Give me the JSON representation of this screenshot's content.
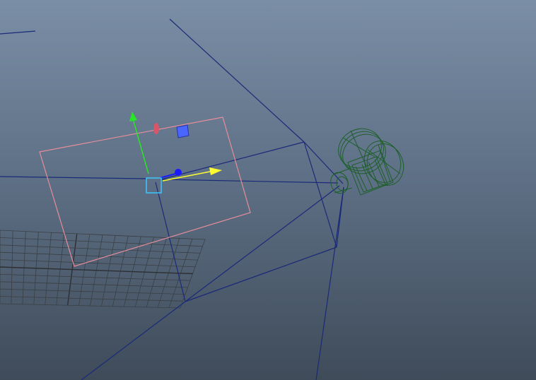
{
  "viewport": {
    "background_top": "#7a8ea5",
    "background_mid": "#5f7187",
    "background_bottom": "#3f4b59"
  },
  "colors": {
    "frustum": "#1a2a78",
    "grid": "#3a3f44",
    "grid_axis": "#2c2f33",
    "image_plane": "#e58d9a",
    "camera_mesh": "#1d5f2a",
    "manip_x": "#ffff30",
    "manip_y": "#26e626",
    "manip_z": "#1a1aff",
    "manip_center": "#3cc6ff",
    "rotate_handle": "#d9566a",
    "scale_handle": "#4a66ff"
  },
  "objects": {
    "ground_grid": "ground-grid",
    "camera": "camera-icon",
    "image_plane": "image-plane",
    "manipulator": "move-manipulator-icon"
  }
}
